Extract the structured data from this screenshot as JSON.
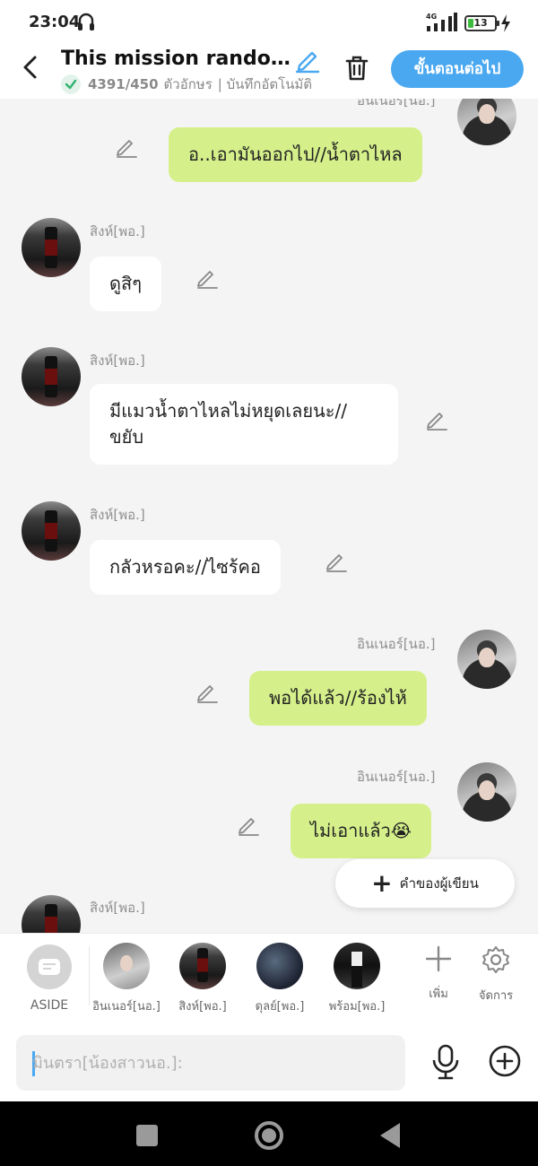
{
  "status": {
    "time": "23:04",
    "network": "4G",
    "battery": "13",
    "battery_level_pct": 13
  },
  "header": {
    "title": "This mission randomly started",
    "count": "4391/450",
    "count_unit": "ตัวอักษร",
    "autosave": "| บันทึกอัตโนมัติ",
    "next_button": "ขั้นตอนต่อไป"
  },
  "chat": {
    "messages": [
      {
        "side": "right",
        "speaker": "อินเนอร์[นอ.]",
        "text": "อ..เอามันออกไป//น้ำตาไหล"
      },
      {
        "side": "left",
        "speaker": "สิงห์[พอ.]",
        "text": "ดูสิๆ"
      },
      {
        "side": "left",
        "speaker": "สิงห์[พอ.]",
        "text": "มีแมวน้ำตาไหลไม่หยุดเลยนะ//ขยับ"
      },
      {
        "side": "left",
        "speaker": "สิงห์[พอ.]",
        "text": "กลัวหรอคะ//ไซร้คอ"
      },
      {
        "side": "right",
        "speaker": "อินเนอร์[นอ.]",
        "text": "พอได้แล้ว//ร้องไห้"
      },
      {
        "side": "right",
        "speaker": "อินเนอร์[นอ.]",
        "text": "ไม่เอาแล้ว😭"
      },
      {
        "side": "left",
        "speaker": "สิงห์[พอ.]",
        "text": ""
      }
    ],
    "writer_button": "คำของผู้เขียน"
  },
  "characters": {
    "aside_label": "ASIDE",
    "list": [
      {
        "label": "อินเนอร์[นอ.]"
      },
      {
        "label": "สิงห์[พอ.]"
      },
      {
        "label": "ดุลย์[พอ.]"
      },
      {
        "label": "พร้อม[พอ.]"
      }
    ],
    "add_label": "เพิ่ม",
    "manage_label": "จัดการ"
  },
  "input": {
    "placeholder": "มินตรา[น้องสาวนอ.]:"
  },
  "colors": {
    "accent": "#4aa8f0",
    "my_bubble": "#d5f08a",
    "other_bubble": "#ffffff",
    "background": "#f4f4f4"
  }
}
